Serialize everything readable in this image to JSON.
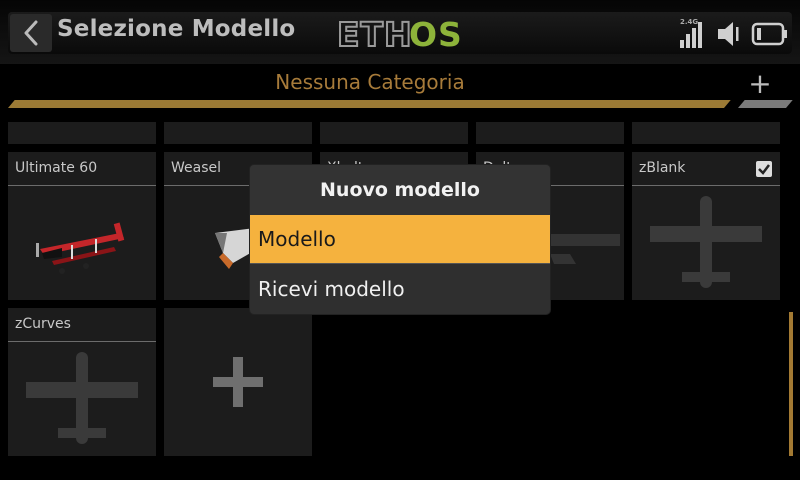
{
  "header": {
    "title": "Selezione Modello",
    "logo_text": "ETHOS",
    "logo_part1": "ETH",
    "logo_part2": "OS",
    "band": "2.4G",
    "icons": [
      "back-arrow-icon",
      "signal-icon",
      "speaker-icon",
      "battery-icon"
    ]
  },
  "category": {
    "label": "Nessuna Categoria",
    "add_label": "+"
  },
  "models": [
    {
      "name": "Ultimate 60",
      "image": "biplane-red"
    },
    {
      "name": "Weasel",
      "image": "flying-wing"
    },
    {
      "name": "Xbolt",
      "image": "airplane"
    },
    {
      "name": "Deltas",
      "image": "airplane"
    },
    {
      "name": "zBlank",
      "image": "airplane-silhouette",
      "checked": true
    },
    {
      "name": "zCurves",
      "image": "airplane-silhouette"
    }
  ],
  "add_model_label": "+",
  "dialog": {
    "title": "Nuovo modello",
    "options": [
      {
        "label": "Modello",
        "selected": true
      },
      {
        "label": "Ricevi modello",
        "selected": false
      }
    ]
  },
  "colors": {
    "accent": "#f5b23e",
    "category_text": "#a77b3a",
    "logo_green": "#8db33a"
  }
}
